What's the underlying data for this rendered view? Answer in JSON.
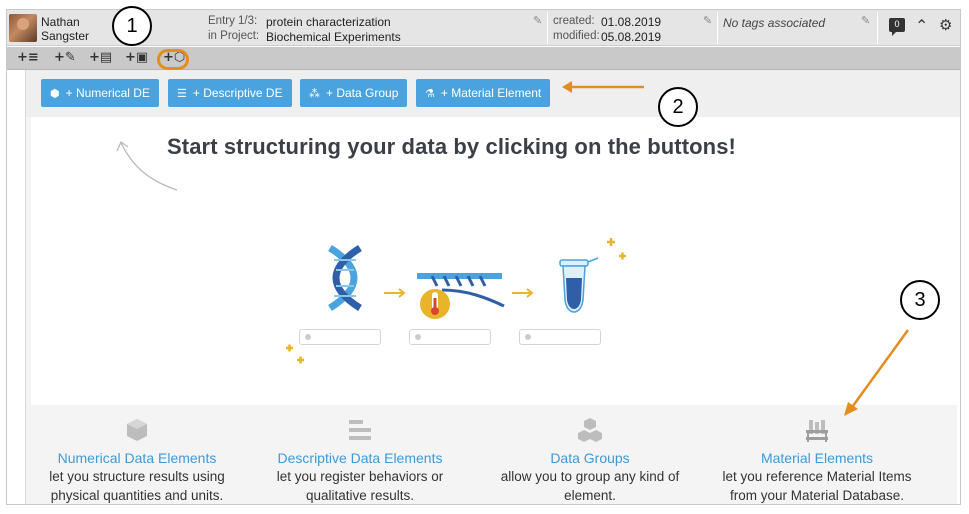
{
  "header": {
    "user_first": "Nathan",
    "user_last": "Sangster",
    "entry_label": "Entry 1/3:",
    "entry_value": "protein characterization",
    "project_label": "in Project:",
    "project_value": "Biochemical Experiments",
    "created_label": "created:",
    "created_value": "01.08.2019",
    "modified_label": "modified:",
    "modified_value": "05.08.2019",
    "tags_text": "No tags associated",
    "comment_count": "0"
  },
  "toolbar": {
    "items": [
      "+≡",
      "+✎",
      "+▤",
      "+▣",
      "+⬡"
    ]
  },
  "buttons": [
    {
      "label": "+ Numerical DE",
      "icon": "cube-icon"
    },
    {
      "label": "+ Descriptive DE",
      "icon": "bars-icon"
    },
    {
      "label": "+ Data Group",
      "icon": "cubes-icon"
    },
    {
      "label": "+ Material Element",
      "icon": "lab-icon"
    }
  ],
  "headline": "Start structuring your data by clicking on the buttons!",
  "features": [
    {
      "title": "Numerical Data Elements",
      "line1": "let you structure results using",
      "line2": "physical quantities and units."
    },
    {
      "title": "Descriptive Data Elements",
      "line1": "let you register behaviors or",
      "line2": "qualitative results."
    },
    {
      "title": "Data Groups",
      "line1": "allow you to group any kind of",
      "line2": "element."
    },
    {
      "title": "Material Elements",
      "line1": "let you reference Material Items",
      "line2": "from your Material Database."
    }
  ],
  "callouts": [
    "1",
    "2",
    "3"
  ],
  "colors": {
    "accent": "#4aa3df",
    "annotation": "#e58c1e",
    "header_bg": "#e5e5e5",
    "toolbar_bg": "#c9c9c9",
    "gold": "#e8b52a"
  }
}
